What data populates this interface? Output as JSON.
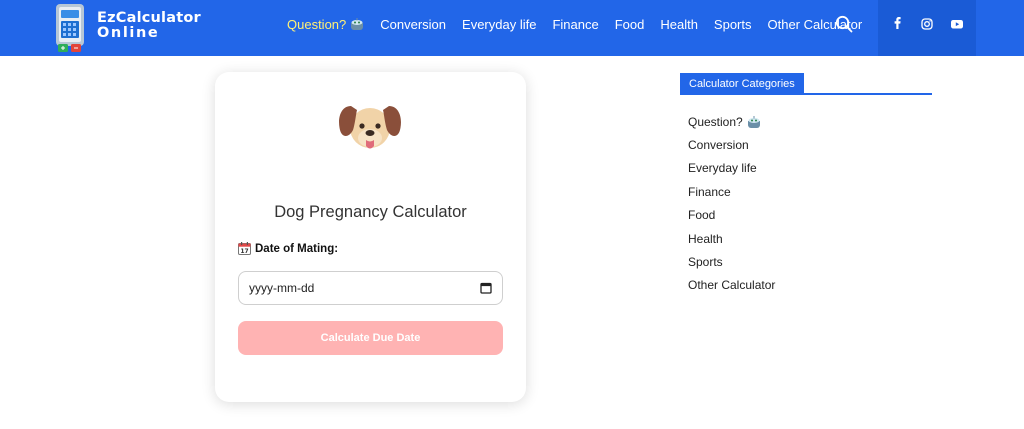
{
  "brand": {
    "name_line1": "EzCalculator",
    "name_line2": "Online"
  },
  "nav": {
    "items": [
      "Question?",
      "Conversion",
      "Everyday life",
      "Finance",
      "Food",
      "Health",
      "Sports",
      "Other Calculator"
    ],
    "active_index": 0
  },
  "calculator": {
    "title": "Dog Pregnancy Calculator",
    "date_label": "Date of Mating:",
    "date_placeholder": "yyyy-mm-dd",
    "button_label": "Calculate Due Date"
  },
  "sidebar": {
    "heading": "Calculator Categories",
    "items": [
      "Question?",
      "Conversion",
      "Everyday life",
      "Finance",
      "Food",
      "Health",
      "Sports",
      "Other Calculator"
    ]
  },
  "colors": {
    "accent": "#2266e8",
    "button": "#ffb3b3",
    "active_nav": "#fff176"
  },
  "icons": [
    "calculator-logo-icon",
    "search-icon",
    "facebook-icon",
    "instagram-icon",
    "youtube-icon",
    "dog-face-icon",
    "calendar-icon",
    "robot-icon"
  ]
}
